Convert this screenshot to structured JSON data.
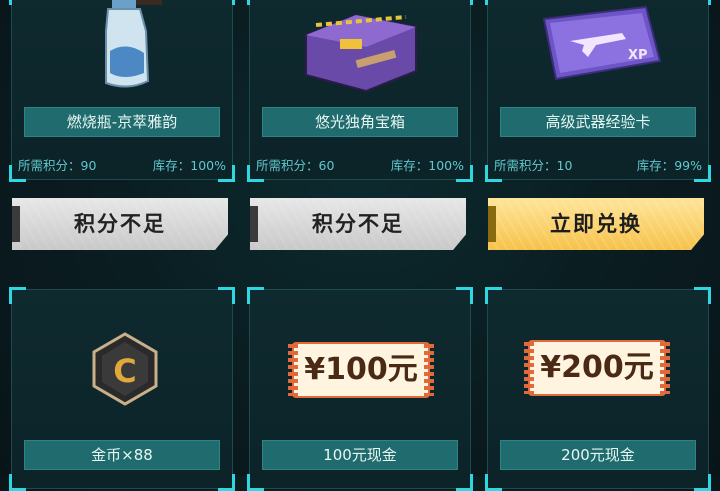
{
  "items_top": [
    {
      "name": "燃烧瓶-京萃雅韵",
      "points_label": "所需积分：90",
      "stock_label": "库存：100%",
      "button": "积分不足",
      "state": "insufficient"
    },
    {
      "name": "悠光独角宝箱",
      "points_label": "所需积分：60",
      "stock_label": "库存：100%",
      "button": "积分不足",
      "state": "insufficient"
    },
    {
      "name": "高级武器经验卡",
      "points_label": "所需积分：10",
      "stock_label": "库存：99%",
      "button": "立即兑换",
      "state": "available",
      "card_badge": "XP"
    }
  ],
  "items_bottom": [
    {
      "name": "金币×88",
      "icon": "coin-badge-icon",
      "badge_letter": "C"
    },
    {
      "name": "100元现金",
      "voucher": "¥100元"
    },
    {
      "name": "200元现金",
      "voucher": "¥200元"
    }
  ],
  "colors": {
    "accent": "#2fd7e0",
    "name_bar": "#1f6b6d",
    "gold_button": "#f6c24a",
    "gray_button": "#d6d6d6"
  }
}
